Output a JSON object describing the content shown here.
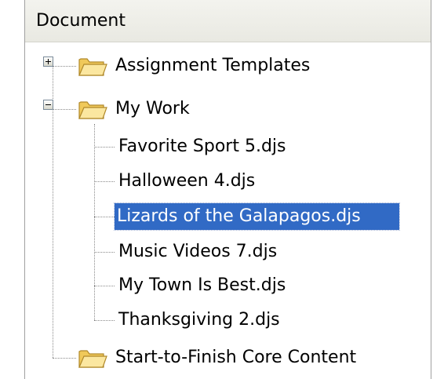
{
  "header": {
    "title": "Document"
  },
  "tree": {
    "folders": [
      {
        "label": "Assignment Templates",
        "expanded": false
      },
      {
        "label": "My Work",
        "expanded": true,
        "files": [
          "Favorite Sport 5.djs",
          "Halloween 4.djs",
          "Lizards of the Galapagos.djs",
          "Music Videos 7.djs",
          "My Town Is Best.djs",
          "Thanksgiving 2.djs"
        ],
        "selected_file": "Lizards of the Galapagos.djs"
      },
      {
        "label": "Start-to-Finish Core Content",
        "expanded": false
      }
    ]
  },
  "colors": {
    "selection": "#316ac5",
    "header_bg": "#eeeee8",
    "folder": "#f5d77a"
  }
}
